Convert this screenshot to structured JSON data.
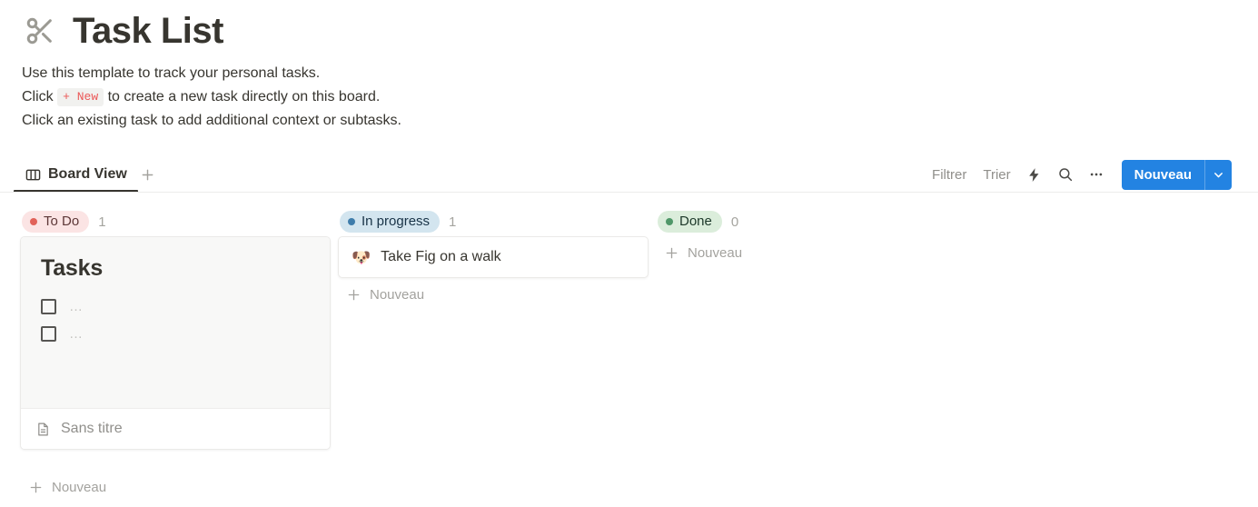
{
  "header": {
    "icon": "scissors-icon",
    "title": "Task List",
    "description_lines": [
      {
        "before": "Use this template to track your personal tasks.",
        "badge": "",
        "after": ""
      },
      {
        "before": "Click ",
        "badge": "+ New",
        "after": " to create a new task directly on this board."
      },
      {
        "before": "Click an existing task to add additional context or subtasks.",
        "badge": "",
        "after": ""
      }
    ]
  },
  "toolbar": {
    "tabs": [
      {
        "label": "Board View",
        "icon": "board-view-icon",
        "active": true
      }
    ],
    "add_tab_label": "+",
    "filter_label": "Filtrer",
    "sort_label": "Trier",
    "automation_icon": "lightning-bolt-icon",
    "search_icon": "search-icon",
    "more_icon": "ellipsis-icon",
    "new_button_label": "Nouveau",
    "new_button_caret_icon": "chevron-down-icon",
    "accent_color": "#2383e2"
  },
  "board": {
    "new_row_label": "Nouveau",
    "columns": [
      {
        "status": "To Do",
        "count": "1",
        "pill_bg": "#fbe4e4",
        "pill_text": "#5d3737",
        "dot_color": "#e16259",
        "cards": [
          {
            "type": "preview",
            "preview_heading": "Tasks",
            "todos": [
              {
                "text": "…",
                "checked": false
              },
              {
                "text": "…",
                "checked": false
              }
            ],
            "footer_icon": "document-icon",
            "footer_label": "Sans titre"
          }
        ],
        "show_new_row": true
      },
      {
        "status": "In progress",
        "count": "1",
        "pill_bg": "#d3e5ef",
        "pill_text": "#183347",
        "dot_color": "#3f7dab",
        "cards": [
          {
            "type": "simple",
            "emoji": "🐶",
            "title": "Take Fig on a walk"
          }
        ],
        "show_new_row": true
      },
      {
        "status": "Done",
        "count": "0",
        "pill_bg": "#dbeddb",
        "pill_text": "#1c3829",
        "dot_color": "#4f9768",
        "cards": [],
        "show_new_row": true
      }
    ]
  }
}
